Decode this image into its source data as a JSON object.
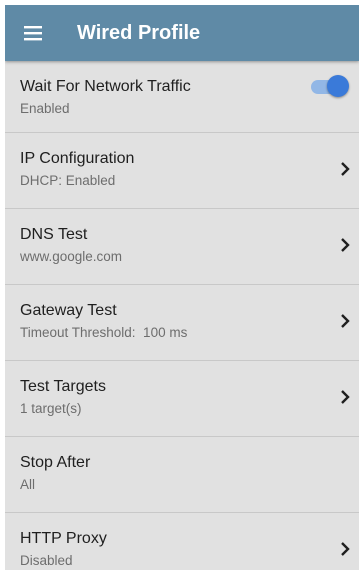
{
  "app": {
    "title": "Wired Profile",
    "menu_icon": "hamburger-menu-icon",
    "accent": "#5f8aa6"
  },
  "settings": [
    {
      "title": "Wait For Network Traffic",
      "value": "Enabled",
      "control": "toggle",
      "toggle_on": true
    },
    {
      "title": "IP Configuration",
      "value": "DHCP: Enabled",
      "control": "chevron"
    },
    {
      "title": "DNS Test",
      "value": "www.google.com",
      "control": "chevron"
    },
    {
      "title": "Gateway Test",
      "value": "Timeout Threshold:  100 ms",
      "control": "chevron"
    },
    {
      "title": "Test Targets",
      "value": "1 target(s)",
      "control": "chevron"
    },
    {
      "title": "Stop After",
      "value": "All",
      "control": "none"
    },
    {
      "title": "HTTP Proxy",
      "value": "Disabled",
      "control": "chevron"
    }
  ]
}
